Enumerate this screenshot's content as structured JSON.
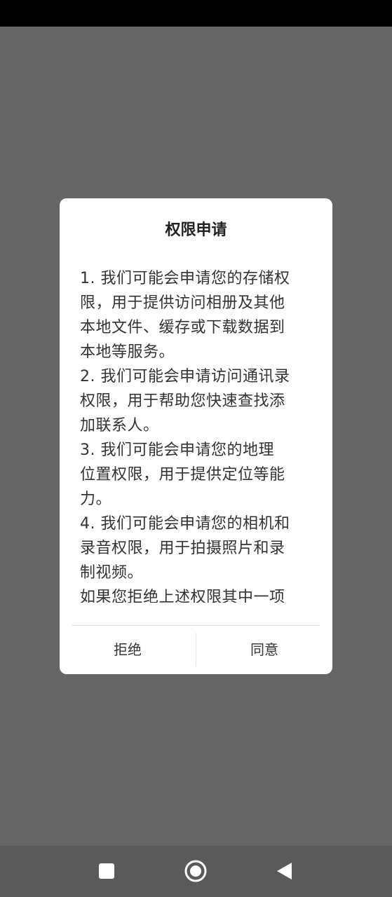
{
  "dialog": {
    "title": "权限申请",
    "lines": [
      "1. 我们可能会申请您的存储权",
      "限，用于提供访问相册及其他",
      "本地文件、缓存或下载数据到",
      "本地等服务。",
      "2. 我们可能会申请访问通讯录",
      "权限，用于帮助您快速查找添",
      "加联系人。",
      "3. 我们可能会申请您的地理",
      "位置权限，用于提供定位等能",
      "力。",
      "4. 我们可能会申请您的相机和",
      "录音权限，用于拍摄照片和录",
      "制视频。",
      "如果您拒绝上述权限其中一项"
    ],
    "reject_label": "拒绝",
    "agree_label": "同意"
  },
  "navigation": {
    "recents_icon": "square-recents-icon",
    "home_icon": "circle-home-icon",
    "back_icon": "triangle-back-icon"
  },
  "colors": {
    "scrim": "#666666",
    "dialog_bg": "#ffffff",
    "text": "#333333",
    "status_bar": "#000000"
  }
}
